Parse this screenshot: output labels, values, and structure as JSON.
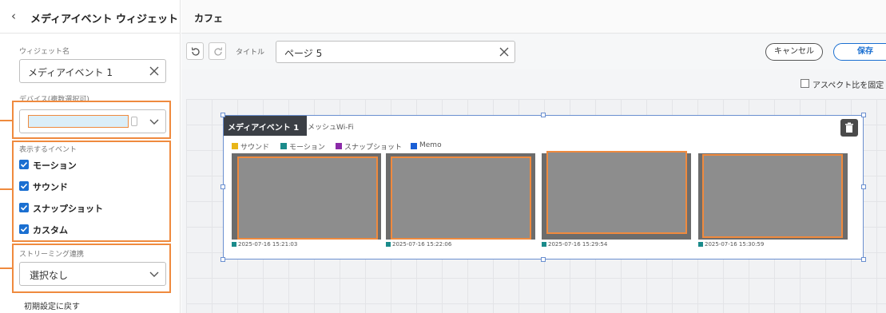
{
  "sidebar": {
    "title": "メディアイベント ウィジェット",
    "widget_name_label": "ウィジェット名",
    "widget_name_value": "メディアイベント 1",
    "device_label": "デバイス(複数選択可)",
    "events_label": "表示するイベント",
    "events": [
      {
        "label": "モーション",
        "checked": true
      },
      {
        "label": "サウンド",
        "checked": true
      },
      {
        "label": "スナップショット",
        "checked": true
      },
      {
        "label": "カスタム",
        "checked": true
      }
    ],
    "streaming_label": "ストリーミング連携",
    "streaming_value": "選択なし",
    "reset_label": "初期設定に戻す"
  },
  "main": {
    "breadcrumb": "カフェ",
    "title_label": "タイトル",
    "title_value": "ページ 5",
    "cancel_label": "キャンセル",
    "save_label": "保存",
    "aspect_label": "アスペクト比を固定"
  },
  "widget": {
    "tab_label": "メディアイベント 1",
    "device_name": "メッシュWi-Fi",
    "legend": [
      {
        "label": "サウンド",
        "color": "#e8b517"
      },
      {
        "label": "モーション",
        "color": "#1b8b8b"
      },
      {
        "label": "スナップショット",
        "color": "#8b2aa8"
      },
      {
        "label": "Memo",
        "color": "#1a5fd6"
      }
    ],
    "thumbnails": [
      {
        "timestamp": "2025-07-16 15:21:03"
      },
      {
        "timestamp": "2025-07-16 15:22:06"
      },
      {
        "timestamp": "2025-07-16 15:29:54"
      },
      {
        "timestamp": "2025-07-16 15:30:59"
      }
    ]
  },
  "colors": {
    "accent": "#1a6fd1",
    "highlight": "#ef8a3e"
  }
}
